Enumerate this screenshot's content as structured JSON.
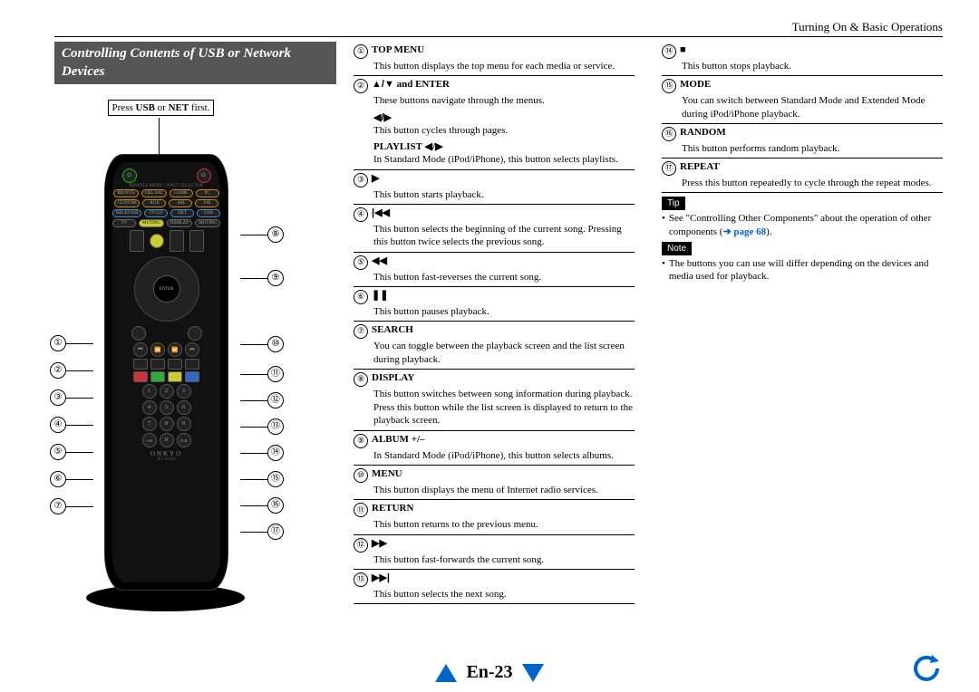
{
  "header": "Turning On & Basic Operations",
  "section_title": "Controlling Contents of USB or Network Devices",
  "callout_pre": "Press ",
  "callout_b1": "USB",
  "callout_mid": " or ",
  "callout_b2": "NET",
  "callout_post": " first.",
  "brand": "ONKYO",
  "model": "RC-834M",
  "left_nums": [
    "①",
    "②",
    "③",
    "④",
    "⑤",
    "⑥",
    "⑦"
  ],
  "right_nums": [
    "⑧",
    "⑨",
    "⑩",
    "⑪",
    "⑫",
    "⑬",
    "⑭",
    "⑮",
    "⑯",
    "⑰"
  ],
  "items1": [
    {
      "n": "①",
      "t": "TOP MENU",
      "d": "This button displays the top menu for each media or service."
    },
    {
      "n": "②",
      "t": "▲/▼ and ENTER",
      "d": "These buttons navigate through the menus.",
      "subs": [
        {
          "t": "◀/▶",
          "d": "This button cycles through pages."
        },
        {
          "t": "PLAYLIST ◀/▶",
          "d": "In Standard Mode (iPod/iPhone), this button selects playlists."
        }
      ]
    },
    {
      "n": "③",
      "t": "▶",
      "d": "This button starts playback."
    },
    {
      "n": "④",
      "t": "|◀◀",
      "d": "This button selects the beginning of the current song. Pressing this button twice selects the previous song."
    },
    {
      "n": "⑤",
      "t": "◀◀",
      "d": "This button fast-reverses the current song."
    },
    {
      "n": "⑥",
      "t": "❚❚",
      "d": "This button pauses playback."
    },
    {
      "n": "⑦",
      "t": "SEARCH",
      "d": "You can toggle between the playback screen and the list screen during playback."
    },
    {
      "n": "⑧",
      "t": "DISPLAY",
      "d": "This button switches between song information during playback.",
      "extra": "Press this button while the list screen is displayed to return to the playback screen."
    },
    {
      "n": "⑨",
      "t": "ALBUM +/–",
      "d": "In Standard Mode (iPod/iPhone), this button selects albums."
    },
    {
      "n": "⑩",
      "t": "MENU",
      "d": "This button displays the menu of Internet radio services."
    },
    {
      "n": "⑪",
      "t": "RETURN",
      "d": "This button returns to the previous menu."
    },
    {
      "n": "⑫",
      "t": "▶▶",
      "d": "This button fast-forwards the current song."
    },
    {
      "n": "⑬",
      "t": "▶▶|",
      "d": "This button selects the next song."
    }
  ],
  "items2": [
    {
      "n": "⑭",
      "t": "■",
      "d": "This button stops playback."
    },
    {
      "n": "⑮",
      "t": "MODE",
      "d": "You can switch between Standard Mode and Extended Mode during iPod/iPhone playback."
    },
    {
      "n": "⑯",
      "t": "RANDOM",
      "d": "This button performs random playback."
    },
    {
      "n": "⑰",
      "t": "REPEAT",
      "d": "Press this button repeatedly to cycle through the repeat modes."
    }
  ],
  "tip_label": "Tip",
  "tip_text": "See \"Controlling Other Components\" about the operation of other components (",
  "tip_link": "➔ page 68",
  "tip_end": ").",
  "note_label": "Note",
  "note_text": "The buttons you can use will differ depending on the devices and media used for playback.",
  "page_num": "En-23",
  "remote": {
    "row1": [
      "BD/DVD",
      "CBL/SAT",
      "GAME",
      "PC"
    ],
    "row2": [
      "CUSTOM",
      "AUX",
      "AM",
      "FM"
    ],
    "row3": [
      "RECEIVER",
      "TV/CD",
      "NET",
      "USB"
    ],
    "row4": [
      "TV",
      "MUTING",
      "DISPLAY",
      "MUTING"
    ],
    "keypad": [
      "1",
      "2",
      "3",
      "4",
      "5",
      "6",
      "7",
      "8",
      "9",
      "+10",
      "0",
      "CLR"
    ]
  }
}
